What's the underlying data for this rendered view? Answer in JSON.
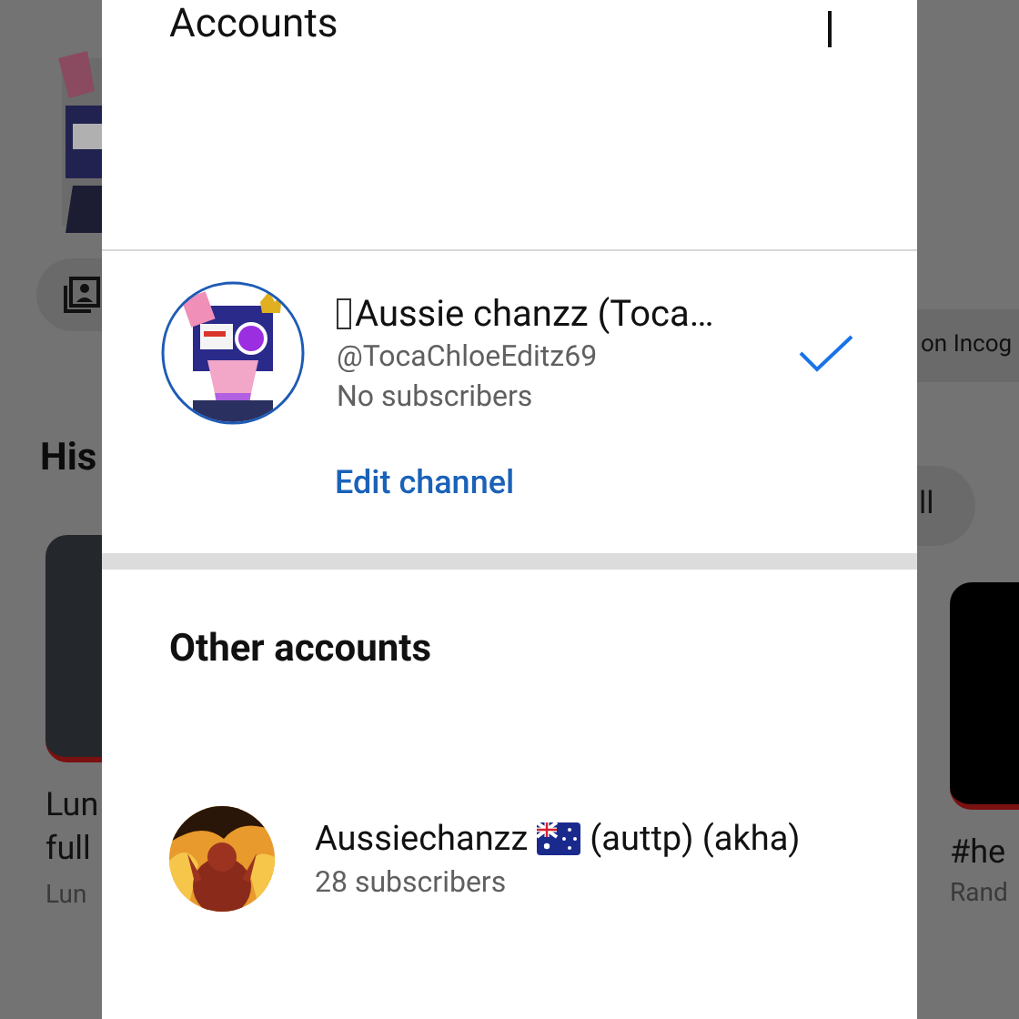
{
  "dialog": {
    "title": "Accounts",
    "current_account": {
      "name": "Aussie chanzz (Toca…",
      "handle": "@TocaChloeEditz69",
      "subscribers": "No subscribers",
      "selected": true,
      "edit_link": "Edit channel"
    },
    "other_accounts_heading": "Other accounts",
    "other_accounts": [
      {
        "name": "Aussiechanzz",
        "name_suffix": "(auttp) (akha)",
        "subscribers": "28 subscribers",
        "selected": false
      }
    ]
  },
  "background": {
    "left": {
      "heading": "His",
      "video_title_lines": [
        "Lun",
        "full"
      ],
      "channel": "Lun"
    },
    "right": {
      "chip": "on Incog",
      "button": "ll",
      "video_title": "#he",
      "channel": "Rand"
    }
  }
}
